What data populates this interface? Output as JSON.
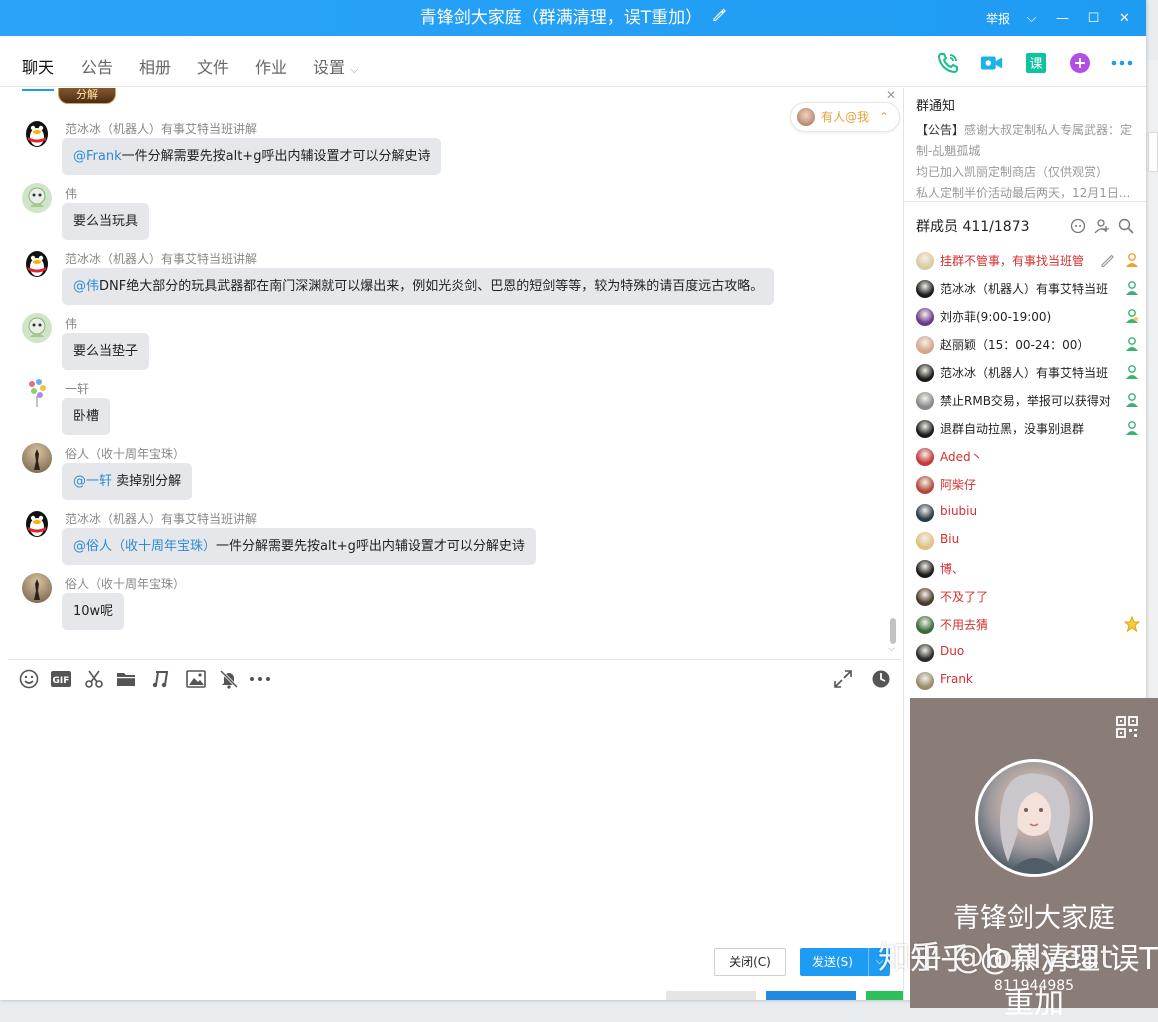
{
  "window": {
    "title": "青锋剑大家庭（群满清理，误T重加）",
    "report": "举报",
    "title_edit_icon": "pencil-icon",
    "controls": [
      "chevron-down-icon",
      "minimize-icon",
      "maximize-icon",
      "close-icon"
    ]
  },
  "tabs": [
    {
      "label": "聊天",
      "active": true
    },
    {
      "label": "公告"
    },
    {
      "label": "相册"
    },
    {
      "label": "文件"
    },
    {
      "label": "作业"
    },
    {
      "label": "设置"
    }
  ],
  "tab_actions": [
    "phone-icon",
    "video-icon",
    "course-icon",
    "plus-icon",
    "more-icon"
  ],
  "tab_action_labels": {
    "course": "课"
  },
  "chat": {
    "top_item_label": "分解",
    "at_me": "有人@我",
    "messages": [
      {
        "sender": "范冰冰（机器人）有事艾特当班讲解",
        "at": "@Frank",
        "text": "一件分解需要先按alt+g呼出内辅设置才可以分解史诗"
      },
      {
        "sender": "伟",
        "at": "",
        "text": "要么当玩具"
      },
      {
        "sender": "范冰冰（机器人）有事艾特当班讲解",
        "at": "@伟",
        "text": "DNF绝大部分的玩具武器都在南门深渊就可以爆出来，例如光炎剑、巴恩的短剑等等，较为特殊的请百度远古攻略。"
      },
      {
        "sender": "伟",
        "at": "",
        "text": "要么当垫子"
      },
      {
        "sender": "一轩",
        "at": "",
        "text": "卧槽"
      },
      {
        "sender": "俗人（收十周年宝珠）",
        "at": "@一轩",
        "text": " 卖掉别分解"
      },
      {
        "sender": "范冰冰（机器人）有事艾特当班讲解",
        "at": "@俗人（收十周年宝珠）",
        "text": "一件分解需要先按alt+g呼出内辅设置才可以分解史诗"
      },
      {
        "sender": "俗人（收十周年宝珠）",
        "at": "",
        "text": "10w呢"
      }
    ]
  },
  "toolbar": [
    "emoji-icon",
    "gif-icon",
    "scissors-icon",
    "folder-icon",
    "music-icon",
    "image-icon",
    "bell-off-icon",
    "more-icon"
  ],
  "toolbar_right": [
    "expand-icon",
    "history-icon"
  ],
  "buttons": {
    "close": "关闭(C)",
    "send": "发送(S)"
  },
  "notice": {
    "title": "群通知",
    "lines": [
      {
        "tag": "【公告】",
        "text": "感谢大叔定制私人专属武器：定"
      },
      {
        "tag": "",
        "text": "制-乩魈孤城"
      },
      {
        "tag": "",
        "text": "均已加入凯丽定制商店（仅供观赏）"
      },
      {
        "tag": "",
        "text": "私人定制半价活动最后两天，12月1日..."
      }
    ]
  },
  "members": {
    "header": "群成员 411/1873",
    "list": [
      {
        "name": "挂群不管事，有事找当班管",
        "red": true,
        "role": "owner"
      },
      {
        "name": "范冰冰（机器人）有事艾特当班",
        "red": false,
        "role": "admin"
      },
      {
        "name": "刘亦菲(9:00-19:00)",
        "red": false,
        "role": "admin-star"
      },
      {
        "name": "赵丽颖（15：00-24：00）",
        "red": false,
        "role": "admin"
      },
      {
        "name": "范冰冰（机器人）有事艾特当班",
        "red": false,
        "role": "admin"
      },
      {
        "name": "禁止RMB交易，举报可以获得对",
        "red": false,
        "role": "admin"
      },
      {
        "name": "退群自动拉黑，没事别退群",
        "red": false,
        "role": "admin"
      },
      {
        "name": "Aded丶",
        "red": true,
        "role": ""
      },
      {
        "name": "阿柴仔",
        "red": true,
        "role": ""
      },
      {
        "name": "biubiu",
        "red": true,
        "role": ""
      },
      {
        "name": "Biu",
        "red": true,
        "role": ""
      },
      {
        "name": "博、",
        "red": true,
        "role": ""
      },
      {
        "name": "不及了了",
        "red": true,
        "role": ""
      },
      {
        "name": "不用去猜",
        "red": true,
        "role": "star"
      },
      {
        "name": "Duo",
        "red": true,
        "role": ""
      },
      {
        "name": "Frank",
        "red": true,
        "role": ""
      }
    ]
  },
  "profile": {
    "name": "青锋剑大家庭",
    "subtitle": "知乎 @慕清理 误T重加",
    "id": "811944985"
  },
  "watermark": "知乎 @lonlyeat"
}
